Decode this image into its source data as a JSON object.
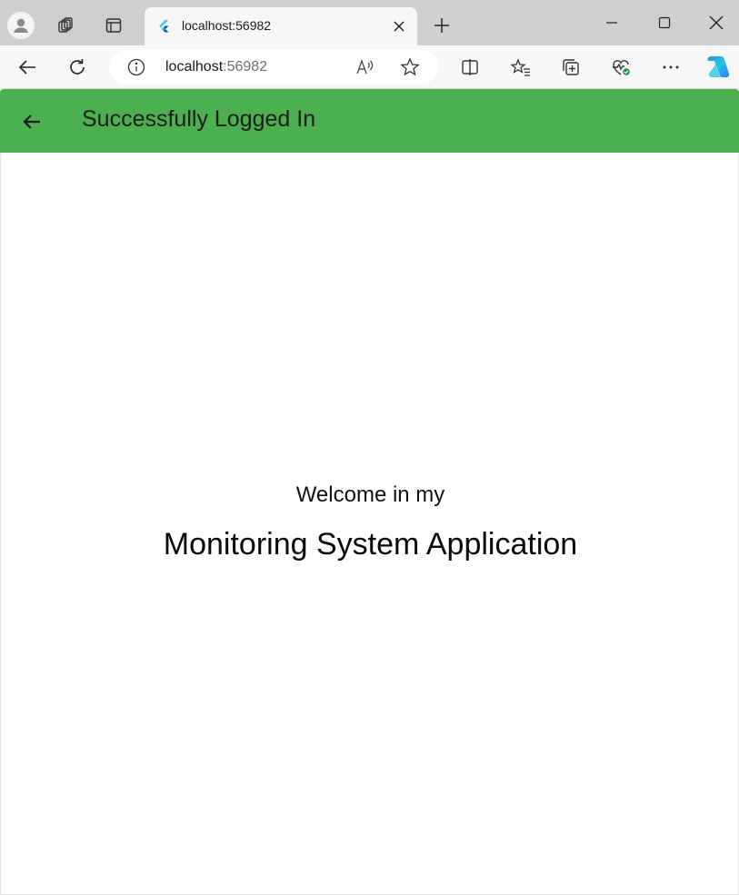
{
  "browser": {
    "tab": {
      "title": "localhost:56982",
      "favicon": "flutter-logo-icon"
    },
    "address_bar": {
      "host": "localhost",
      "port": ":56982"
    },
    "icons": {
      "profile": "profile-avatar-icon",
      "workspaces": "workspaces-icon",
      "tab_actions": "vertical-tabs-icon",
      "new_tab": "plus-icon",
      "minimize": "minimize-icon",
      "maximize": "maximize-icon",
      "close": "close-icon",
      "back": "arrow-left-icon",
      "refresh": "refresh-icon",
      "site_info": "info-icon",
      "read_aloud": "read-aloud-icon",
      "favorite": "star-icon",
      "split_screen": "split-screen-icon",
      "favorites": "favorites-list-icon",
      "collections": "collections-icon",
      "browser_essentials": "heart-pulse-icon",
      "more": "ellipsis-icon",
      "copilot": "copilot-icon"
    },
    "read_aloud_glyph": "Aͅ"
  },
  "app": {
    "appbar": {
      "title": "Successfully Logged In",
      "back_icon": "arrow-left-icon",
      "color": "#4caf50"
    },
    "body": {
      "welcome": "Welcome in my",
      "app_name": "Monitoring System Application"
    }
  }
}
